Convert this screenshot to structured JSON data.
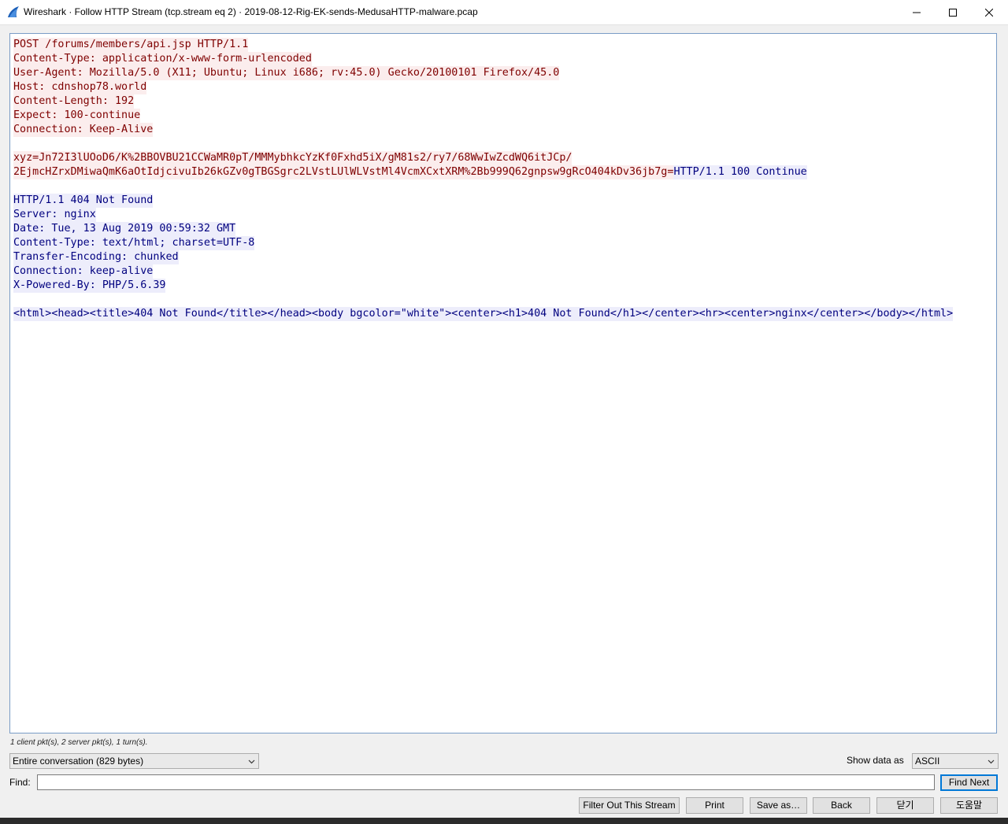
{
  "window": {
    "app_name": "Wireshark",
    "title": "Wireshark · Follow HTTP Stream (tcp.stream eq 2) · 2019-08-12-Rig-EK-sends-MedusaHTTP-malware.pcap"
  },
  "stream": {
    "lines": [
      {
        "segments": [
          {
            "text": "POST /forums/members/api.jsp HTTP/1.1",
            "dir": "client"
          }
        ]
      },
      {
        "segments": [
          {
            "text": "Content-Type: application/x-www-form-urlencoded",
            "dir": "client"
          }
        ]
      },
      {
        "segments": [
          {
            "text": "User-Agent: Mozilla/5.0 (X11; Ubuntu; Linux i686; rv:45.0) Gecko/20100101 Firefox/45.0",
            "dir": "client"
          }
        ]
      },
      {
        "segments": [
          {
            "text": "Host: cdnshop78.world",
            "dir": "client"
          }
        ]
      },
      {
        "segments": [
          {
            "text": "Content-Length: 192",
            "dir": "client"
          }
        ]
      },
      {
        "segments": [
          {
            "text": "Expect: 100-continue",
            "dir": "client"
          }
        ]
      },
      {
        "segments": [
          {
            "text": "Connection: Keep-Alive",
            "dir": "client"
          }
        ]
      },
      {
        "segments": []
      },
      {
        "segments": [
          {
            "text": "xyz=Jn72I3lUOoD6/K%2BBOVBU21CCWaMR0pT/MMMybhkcYzKf0Fxhd5iX/gM81s2/ry7/68WwIwZcdWQ6itJCp/",
            "dir": "client"
          }
        ]
      },
      {
        "segments": [
          {
            "text": "2EjmcHZrxDMiwaQmK6aOtIdjcivuIb26kGZv0gTBGSgrc2LVstLUlWLVstMl4VcmXCxtXRM%2Bb999Q62gnpsw9gRcO404kDv36jb7g=",
            "dir": "client"
          },
          {
            "text": "HTTP/1.1 100 Continue",
            "dir": "server"
          }
        ]
      },
      {
        "segments": []
      },
      {
        "segments": [
          {
            "text": "HTTP/1.1 404 Not Found",
            "dir": "server"
          }
        ]
      },
      {
        "segments": [
          {
            "text": "Server: nginx",
            "dir": "server"
          }
        ]
      },
      {
        "segments": [
          {
            "text": "Date: Tue, 13 Aug 2019 00:59:32 GMT",
            "dir": "server"
          }
        ]
      },
      {
        "segments": [
          {
            "text": "Content-Type: text/html; charset=UTF-8",
            "dir": "server"
          }
        ]
      },
      {
        "segments": [
          {
            "text": "Transfer-Encoding: chunked",
            "dir": "server"
          }
        ]
      },
      {
        "segments": [
          {
            "text": "Connection: keep-alive",
            "dir": "server"
          }
        ]
      },
      {
        "segments": [
          {
            "text": "X-Powered-By: PHP/5.6.39",
            "dir": "server"
          }
        ]
      },
      {
        "segments": []
      },
      {
        "segments": [
          {
            "text": "<html><head><title>404 Not Found</title></head><body bgcolor=\"white\"><center><h1>404 Not Found</h1></center><hr><center>nginx</center></body></html>",
            "dir": "server"
          }
        ]
      }
    ]
  },
  "stats": "1 client pkt(s), 2 server pkt(s), 1 turn(s).",
  "conversation_select": {
    "value": "Entire conversation (829 bytes)"
  },
  "show_data_as": {
    "label": "Show data as",
    "value": "ASCII"
  },
  "find": {
    "label": "Find:",
    "value": "",
    "find_next_label": "Find Next"
  },
  "buttons": {
    "filter_out": "Filter Out This Stream",
    "print": "Print",
    "save_as": "Save as…",
    "back": "Back",
    "close": "닫기",
    "help": "도움말"
  },
  "colors": {
    "client_bg": "#fbeded",
    "client_fg": "#7f0000",
    "server_bg": "#ededfb",
    "server_fg": "#00007f",
    "accent": "#0078d7"
  }
}
